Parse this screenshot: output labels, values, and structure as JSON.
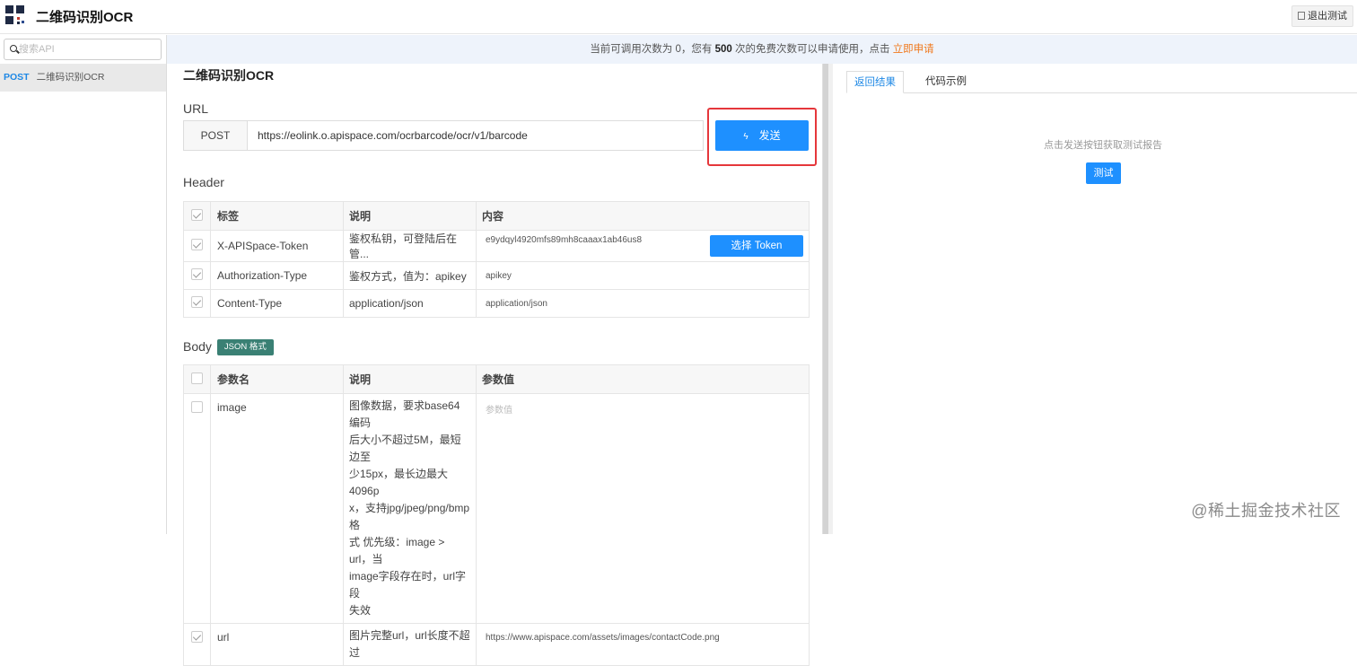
{
  "app": {
    "title": "二维码识别OCR",
    "exit_label": "退出测试"
  },
  "notice": {
    "prefix": "当前可调用次数为 0，您有 ",
    "count": "500",
    "suffix": " 次的免费次数可以申请使用，点击 ",
    "link": "立即申请"
  },
  "sidebar": {
    "search_placeholder": "搜索API",
    "items": [
      {
        "method": "POST",
        "label": "二维码识别OCR"
      }
    ]
  },
  "main": {
    "title": "二维码识别OCR",
    "url_section": "URL",
    "method": "POST",
    "url": "https://eolink.o.apispace.com/ocrbarcode/ocr/v1/barcode",
    "send_label": "发送",
    "header_section": "Header",
    "header_table": {
      "columns": [
        "标签",
        "说明",
        "内容"
      ],
      "rows": [
        {
          "checked": true,
          "tag": "X-APISpace-Token",
          "desc": "鉴权私钥，可登陆后在管...",
          "value": "e9ydqyl4920mfs89mh8caaax1ab46us8",
          "action": "选择 Token"
        },
        {
          "checked": true,
          "tag": "Authorization-Type",
          "desc": "鉴权方式，值为：apikey",
          "value": "apikey"
        },
        {
          "checked": true,
          "tag": "Content-Type",
          "desc": "application/json",
          "value": "application/json"
        }
      ]
    },
    "body_section": "Body",
    "body_badge": "JSON 格式",
    "body_table": {
      "columns": [
        "参数名",
        "说明",
        "参数值"
      ],
      "rows": [
        {
          "checked": false,
          "name": "image",
          "desc_lines": [
            "图像数据，要求base64编码",
            "后大小不超过5M，最短边至",
            "少15px，最长边最大4096p",
            "x，支持jpg/jpeg/png/bmp格",
            "式 优先级：image > url，当",
            "image字段存在时，url字段",
            "失效"
          ],
          "value": "",
          "placeholder": "参数值"
        },
        {
          "checked": true,
          "name": "url",
          "desc_lines": [
            "图片完整url，url长度不超过"
          ],
          "value": "https://www.apispace.com/assets/images/contactCode.png"
        }
      ]
    }
  },
  "right": {
    "tabs": [
      "返回结果",
      "代码示例"
    ],
    "hint": "点击发送按钮获取测试报告",
    "test_label": "测试"
  },
  "watermark": "@稀土掘金技术社区"
}
